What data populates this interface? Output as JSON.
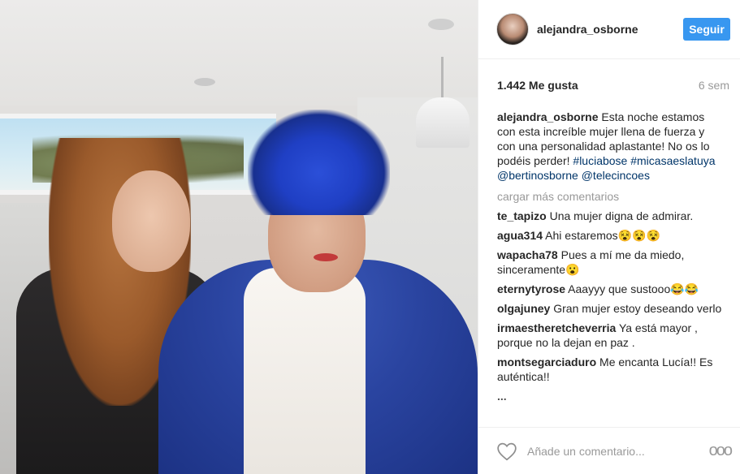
{
  "post": {
    "author": "alejandra_osborne",
    "follow_label": "Seguir",
    "likes": "1.442 Me gusta",
    "time_ago": "6 sem",
    "caption": {
      "user": "alejandra_osborne",
      "text": " Esta noche estamos con esta increíble mujer llena de fuerza y con una personalidad aplastante! No os lo podéis perder! ",
      "hashtags": [
        "#luciabose",
        "#micasaeslatuya"
      ],
      "mentions": [
        "@bertinosborne",
        "@telecincoes"
      ]
    },
    "load_more": "cargar más comentarios",
    "comments": [
      {
        "user": "te_tapizo",
        "text": " Una mujer digna de admirar."
      },
      {
        "user": "agua314",
        "text": " Ahi estaremos😵😵😵"
      },
      {
        "user": "wapacha78",
        "text": " Pues a mí me da miedo, sinceramente😮"
      },
      {
        "user": "eternytyrose",
        "text": " Aaayyy que sustooo😂😂"
      },
      {
        "user": "olgajuney",
        "text": " Gran mujer estoy deseando verlo"
      },
      {
        "user": "irmaestheretcheverria",
        "text": " Ya está mayor , porque no la dejan en paz ."
      },
      {
        "user": "montsegarciaduro",
        "text": " Me encanta Lucía!! Es auténtica!!"
      },
      {
        "user": "...",
        "text": ""
      }
    ],
    "add_comment_placeholder": "Añade un comentario...",
    "more_label": "ooo"
  },
  "icons": {
    "like": "heart-outline-icon",
    "more": "more-options-icon"
  },
  "colors": {
    "follow_bg": "#3897f0",
    "link": "#003569",
    "muted": "#999999"
  }
}
